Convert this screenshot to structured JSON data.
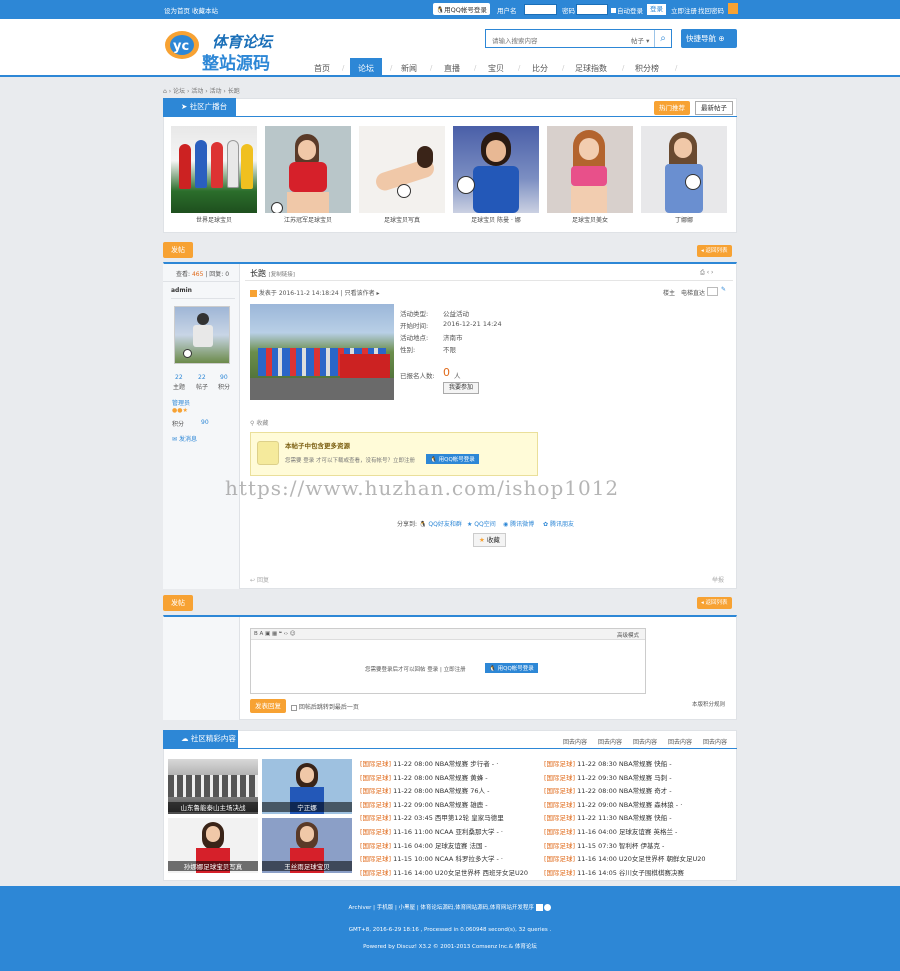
{
  "topbar": {
    "set_home": "设为首页",
    "favorite": "收藏本站",
    "qq_login": "用QQ帐号登录",
    "username_label": "用户名",
    "autologin": "自动登录",
    "password_label": "密码",
    "retrieve": "找回密码",
    "login": "登录",
    "register": "立即注册",
    "quick_login": "快捷导航"
  },
  "header": {
    "logo_line1": "体育论坛",
    "logo_line2": "整站源码",
    "search_placeholder": "请输入搜索内容",
    "search_type": "帖子",
    "quick_nav": "快捷导航"
  },
  "nav": {
    "items": [
      "首页",
      "论坛",
      "新闻",
      "直播",
      "宝贝",
      "比分",
      "足球指数",
      "积分榜"
    ],
    "active": "论坛"
  },
  "breadcrumb": [
    "论坛",
    "活动",
    "活动",
    "长跑"
  ],
  "community": {
    "title": "社区广播台",
    "hot_btn": "热门推荐",
    "new_btn": "最新帖子",
    "pics": [
      {
        "caption": "世界足球宝贝"
      },
      {
        "caption": "江苏冠军足球宝贝"
      },
      {
        "caption": "足球宝贝写真"
      },
      {
        "caption": "足球宝贝 陈曼 · 娜"
      },
      {
        "caption": "足球宝贝美女"
      },
      {
        "caption": "丁娜娜"
      }
    ]
  },
  "post": {
    "reply_btn": "发帖",
    "return_list": "返回列表",
    "views_label": "查看:",
    "views": "465",
    "replies_label": "回复:",
    "replies": "0",
    "title": "长跑",
    "category": "[复制链接]",
    "author": "admin",
    "posted": "发表于 2016-11-2 14:18:24",
    "view_author": "只看该作者",
    "floor_label": "楼主",
    "jump_label": "电梯直达",
    "stats": [
      {
        "num": "22",
        "label": "主题"
      },
      {
        "num": "22",
        "label": "帖子"
      },
      {
        "num": "90",
        "label": "积分"
      }
    ],
    "role": "管理员",
    "points_label": "积分",
    "points": "90",
    "send_msg": "发消息",
    "activity": {
      "type_label": "活动类型:",
      "type": "公益活动",
      "time_label": "开始时间:",
      "time": "2016-12-21 14:24",
      "place_label": "活动地点:",
      "place": "济南市",
      "gender_label": "性别:",
      "gender": "不限",
      "signed_label": "已报名人数:",
      "signed_count": "0",
      "signed_unit": "人",
      "join_btn": "我要参加"
    },
    "favorite": "收藏",
    "hidden": {
      "title": "本帖子中包含更多资源",
      "text": "您需要 登录 才可以下载或查看，没有帐号？立即注册",
      "qq_btn": "用QQ帐号登录"
    },
    "share_label": "分享到:",
    "share": [
      "QQ好友和群",
      "QQ空间",
      "腾讯微博",
      "腾讯朋友"
    ],
    "support": "收藏",
    "reply_link": "回复",
    "report": "举报"
  },
  "watermark": "https://www.huzhan.com/ishop1012",
  "reply": {
    "reply_btn": "发帖",
    "return_list": "返回列表",
    "login_prompt": "您需要登录后才可以回帖 登录 | 立即注册",
    "qq_btn": "用QQ帐号登录",
    "submit": "发表回复",
    "checkbox_label": "回帖后跳转到最后一页",
    "signature": "本版积分规则",
    "mode": "高级模式"
  },
  "highlights": {
    "title": "社区精彩内容",
    "links": [
      "回去内容",
      "回去内容",
      "回去内容",
      "回去内容",
      "回去内容"
    ],
    "pics": [
      {
        "caption": "山东鲁能泰山主场决战"
      },
      {
        "caption": "宁正娜"
      },
      {
        "caption": "孙娜娜足球宝贝写真"
      },
      {
        "caption": "王丝雨足球宝贝"
      }
    ],
    "left_news": [
      {
        "tag": "[国际足球]",
        "text": "11-22 08:00 NBA常规赛 步行者 - ·"
      },
      {
        "tag": "[国际足球]",
        "text": "11-22 08:00 NBA常规赛 黄蜂 -"
      },
      {
        "tag": "[国际足球]",
        "text": "11-22 08:00 NBA常规赛 76人 -"
      },
      {
        "tag": "[国际足球]",
        "text": "11-22 09:00 NBA常规赛 雄鹿 -"
      },
      {
        "tag": "[国际足球]",
        "text": "11-22 03:45 西甲第12轮 皇家马德里"
      },
      {
        "tag": "[国际足球]",
        "text": "11-16 11:00 NCAA 亚利桑那大学 - ·"
      },
      {
        "tag": "[国际足球]",
        "text": "11-16 04:00 足球友谊赛 法国 -"
      },
      {
        "tag": "[国际足球]",
        "text": "11-15 10:00 NCAA 科罗拉多大学 - ·"
      },
      {
        "tag": "[国际足球]",
        "text": "11-16 14:00 U20女足世界杯 西班牙女足U20"
      }
    ],
    "right_news": [
      {
        "tag": "[国际足球]",
        "text": "11-22 08:30 NBA常规赛 快船 -"
      },
      {
        "tag": "[国际足球]",
        "text": "11-22 09:30 NBA常规赛 马刺 -"
      },
      {
        "tag": "[国际足球]",
        "text": "11-22 08:00 NBA常规赛 奇才 -"
      },
      {
        "tag": "[国际足球]",
        "text": "11-22 09:00 NBA常规赛 森林狼 - ·"
      },
      {
        "tag": "[国际足球]",
        "text": "11-22 11:30 NBA常规赛 快船 -"
      },
      {
        "tag": "[国际足球]",
        "text": "11-16 04:00 足球友谊赛 英格兰 -"
      },
      {
        "tag": "[国际足球]",
        "text": "11-15 07:30 智利杯 伊基克 -"
      },
      {
        "tag": "[国际足球]",
        "text": "11-16 14:00 U20女足世界杯 朝鲜女足U20"
      },
      {
        "tag": "[国际足球]",
        "text": "11-16 14:05 谷川女子围棋棋赛决赛"
      }
    ]
  },
  "footer": {
    "links": "Archiver | 手机版 | 小黑屋 | 体育论坛源码,体育网站源码,体育网站开发程序",
    "line2": "GMT+8, 2016-6-29 18:16 , Processed in 0.060948 second(s), 32 queries .",
    "line3": "Powered by Discuz! X3.2 © 2001-2013 Comsenz Inc.& 体育论坛"
  },
  "colors": {
    "brand": "#2d87d6",
    "accent": "#f7a233",
    "background": "#e9ebee"
  }
}
